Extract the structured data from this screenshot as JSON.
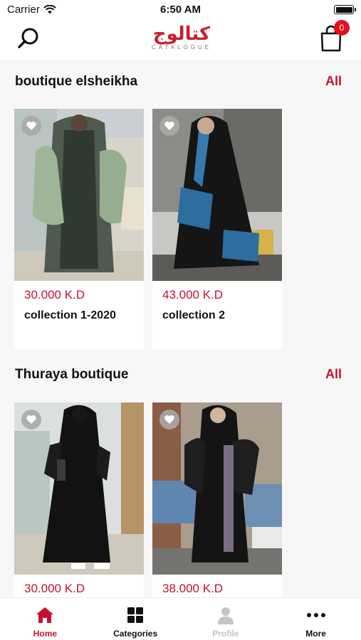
{
  "status_bar": {
    "carrier": "Carrier",
    "time": "6:50 AM"
  },
  "header": {
    "logo_text": "كتالوج",
    "logo_subtitle": "CATALOGUE",
    "cart_count": "0",
    "icons": {
      "search": "search-icon",
      "cart": "shopping-bag-icon"
    }
  },
  "sections": [
    {
      "title": "boutique elsheikha",
      "all_label": "All",
      "products": [
        {
          "price": "30.000 K.D",
          "name": "collection 1-2020",
          "favorite_icon": "heart-icon"
        },
        {
          "price": "43.000 K.D",
          "name": "collection  2",
          "favorite_icon": "heart-icon"
        }
      ]
    },
    {
      "title": "Thuraya boutique",
      "all_label": "All",
      "products": [
        {
          "price": "30.000 K.D",
          "name": "",
          "favorite_icon": "heart-icon"
        },
        {
          "price": "38.000 K.D",
          "name": "",
          "favorite_icon": "heart-icon"
        }
      ]
    }
  ],
  "tab_bar": {
    "items": [
      {
        "label": "Home",
        "icon": "home-icon",
        "state": "active"
      },
      {
        "label": "Categories",
        "icon": "grid-icon",
        "state": "normal"
      },
      {
        "label": "Profile",
        "icon": "user-icon",
        "state": "disabled"
      },
      {
        "label": "More",
        "icon": "more-icon",
        "state": "normal"
      }
    ]
  },
  "colors": {
    "accent": "#c8102e",
    "badge": "#e3101b",
    "background": "#f7f7f7"
  }
}
